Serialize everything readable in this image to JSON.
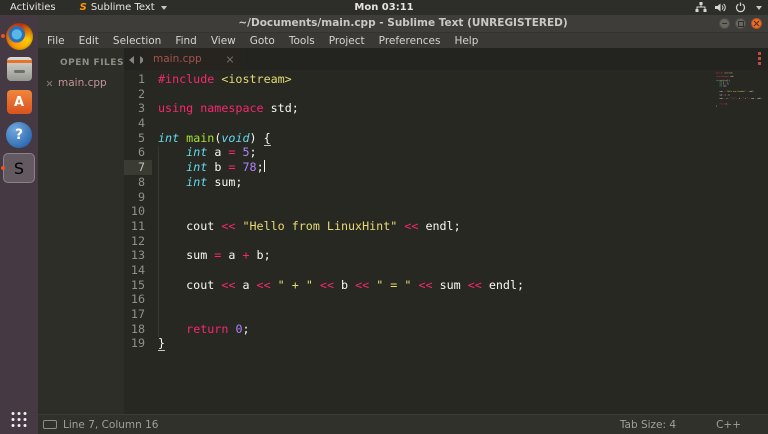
{
  "colors": {
    "keyword": "#f92672",
    "type": "#66d9ef",
    "function": "#a6e22e",
    "string": "#e6db74",
    "number": "#ae81ff",
    "foreground": "#f8f8f2",
    "editor_background": "#272822",
    "accent_orange": "#e95420",
    "tab_label": "#a5524d"
  },
  "topbar": {
    "activities_label": "Activities",
    "app_menu_label": "Sublime Text",
    "clock": "Mon 03:11",
    "tray_icons": [
      "network-icon",
      "volume-icon",
      "power-icon",
      "caret-down-icon"
    ]
  },
  "dock": {
    "items": [
      {
        "name": "firefox",
        "icon": "firefox-icon",
        "glyph": "",
        "running": true,
        "active": false
      },
      {
        "name": "files",
        "icon": "files-icon",
        "glyph": "",
        "running": false,
        "active": false
      },
      {
        "name": "ubuntu-software",
        "icon": "ubuntu-software-icon",
        "glyph": "A",
        "running": false,
        "active": false
      },
      {
        "name": "help",
        "icon": "help-icon",
        "glyph": "?",
        "running": false,
        "active": false
      },
      {
        "name": "sublime-text",
        "icon": "sublime-text-icon",
        "glyph": "S",
        "running": true,
        "active": true
      }
    ]
  },
  "window": {
    "title": "~/Documents/main.cpp - Sublime Text (UNREGISTERED)",
    "menu_items": [
      "File",
      "Edit",
      "Selection",
      "Find",
      "View",
      "Goto",
      "Tools",
      "Project",
      "Preferences",
      "Help"
    ],
    "sidebar": {
      "header": "OPEN FILES",
      "files": [
        "main.cpp"
      ]
    },
    "tabs": [
      {
        "label": "main.cpp",
        "active": true
      }
    ],
    "statusbar": {
      "position": "Line 7, Column 16",
      "tab_size": "Tab Size: 4",
      "syntax": "C++"
    }
  },
  "editor": {
    "current_line": 7,
    "cursor": {
      "line": 7,
      "column": 16
    },
    "lines": [
      [
        [
          "k",
          "#include "
        ],
        [
          "s",
          "<iostream>"
        ]
      ],
      [],
      [
        [
          "k",
          "using"
        ],
        [
          "w",
          " "
        ],
        [
          "k",
          "namespace"
        ],
        [
          "w",
          " std;"
        ]
      ],
      [],
      [
        [
          "t",
          "int"
        ],
        [
          "w",
          " "
        ],
        [
          "f",
          "main"
        ],
        [
          "w",
          "("
        ],
        [
          "t",
          "void"
        ],
        [
          "w",
          ") "
        ],
        [
          "b",
          "{"
        ]
      ],
      [
        [
          "w",
          "    "
        ],
        [
          "t",
          "int"
        ],
        [
          "w",
          " a "
        ],
        [
          "k",
          "="
        ],
        [
          "w",
          " "
        ],
        [
          "n",
          "5"
        ],
        [
          "w",
          ";"
        ]
      ],
      [
        [
          "w",
          "    "
        ],
        [
          "t",
          "int"
        ],
        [
          "w",
          " b "
        ],
        [
          "k",
          "="
        ],
        [
          "w",
          " "
        ],
        [
          "n",
          "78"
        ],
        [
          "w",
          ";"
        ]
      ],
      [
        [
          "w",
          "    "
        ],
        [
          "t",
          "int"
        ],
        [
          "w",
          " sum;"
        ]
      ],
      [],
      [],
      [
        [
          "w",
          "    cout "
        ],
        [
          "k",
          "<<"
        ],
        [
          "w",
          " "
        ],
        [
          "s",
          "\"Hello from LinuxHint\""
        ],
        [
          "w",
          " "
        ],
        [
          "k",
          "<<"
        ],
        [
          "w",
          " endl;"
        ]
      ],
      [],
      [
        [
          "w",
          "    sum "
        ],
        [
          "k",
          "="
        ],
        [
          "w",
          " a "
        ],
        [
          "k",
          "+"
        ],
        [
          "w",
          " b;"
        ]
      ],
      [],
      [
        [
          "w",
          "    cout "
        ],
        [
          "k",
          "<<"
        ],
        [
          "w",
          " a "
        ],
        [
          "k",
          "<<"
        ],
        [
          "w",
          " "
        ],
        [
          "s",
          "\" + \""
        ],
        [
          "w",
          " "
        ],
        [
          "k",
          "<<"
        ],
        [
          "w",
          " b "
        ],
        [
          "k",
          "<<"
        ],
        [
          "w",
          " "
        ],
        [
          "s",
          "\" = \""
        ],
        [
          "w",
          " "
        ],
        [
          "k",
          "<<"
        ],
        [
          "w",
          " sum "
        ],
        [
          "k",
          "<<"
        ],
        [
          "w",
          " endl;"
        ]
      ],
      [],
      [],
      [
        [
          "w",
          "    "
        ],
        [
          "k",
          "return"
        ],
        [
          "w",
          " "
        ],
        [
          "n",
          "0"
        ],
        [
          "w",
          ";"
        ]
      ],
      [
        [
          "b",
          "}"
        ]
      ]
    ]
  }
}
